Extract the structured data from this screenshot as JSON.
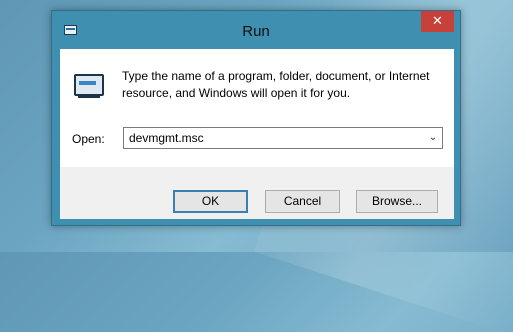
{
  "window": {
    "title": "Run",
    "close_glyph": "✕",
    "icon": "run-app-icon"
  },
  "dialog": {
    "description": "Type the name of a program, folder, document, or Internet resource, and Windows will open it for you.",
    "icon": "run-program-icon",
    "open_label": "Open:",
    "open_value": "devmgmt.msc",
    "dropdown_glyph": "⌄"
  },
  "buttons": {
    "ok": "OK",
    "cancel": "Cancel",
    "browse": "Browse..."
  },
  "colors": {
    "window_frame": "#3f8fb1",
    "close_button": "#c7413a",
    "default_button_border": "#3c7fb1"
  }
}
